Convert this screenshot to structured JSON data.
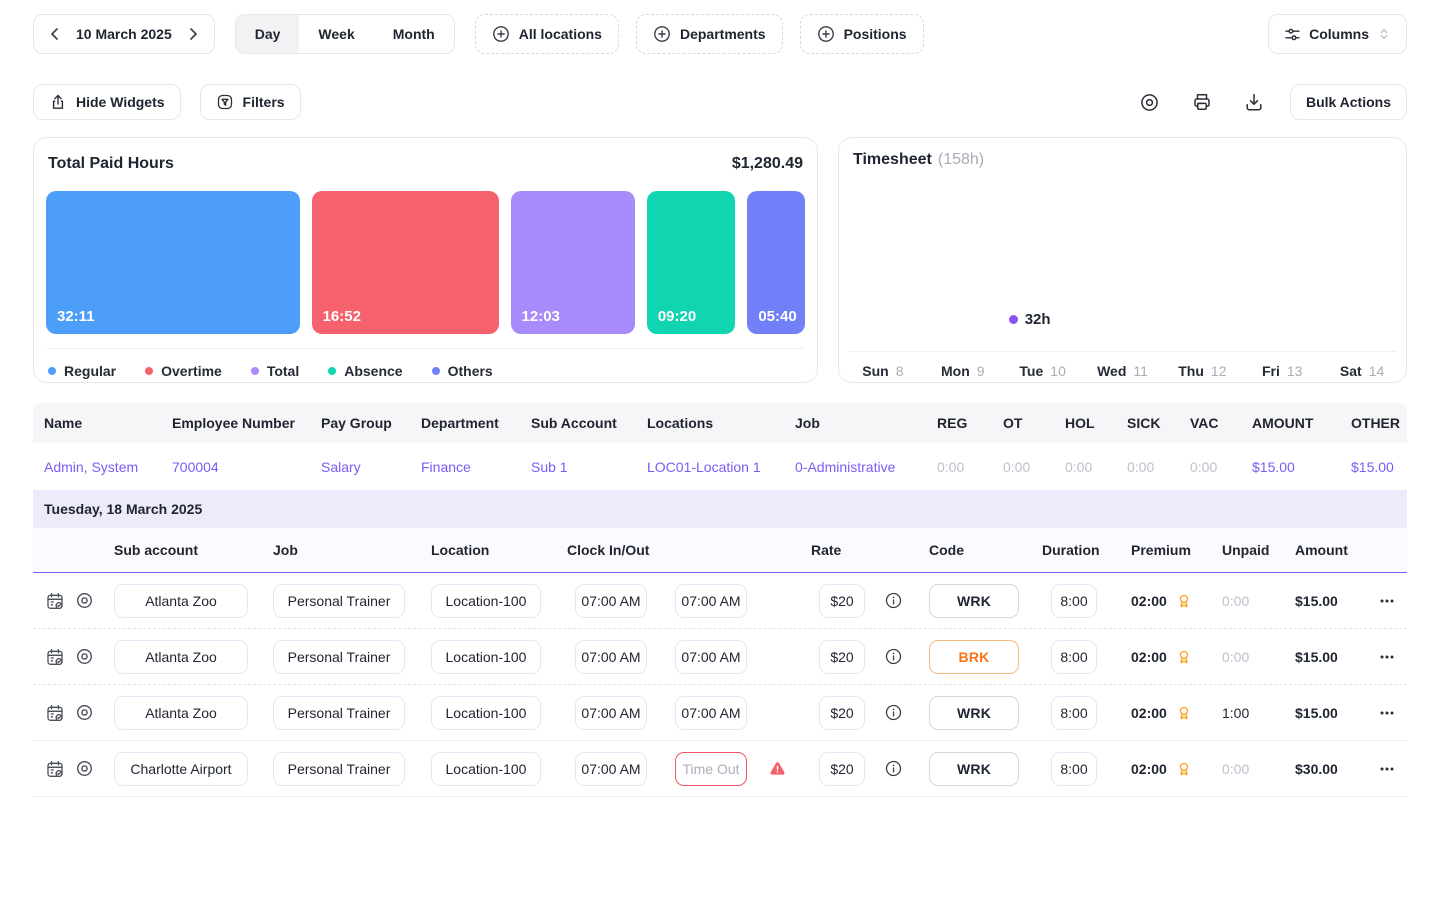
{
  "colors": {
    "accent_purple": "#7B5BF5",
    "bar_blue": "#4D9EF8",
    "bar_red": "#F5626D",
    "bar_purple": "#A78BFA",
    "bar_teal": "#10D5B0",
    "bar_indigo": "#7180F8",
    "timesheet_bar_purple": "#8A53F3",
    "timesheet_bar_gray": "#F4F4F5",
    "brk_orange": "#F97316",
    "premium_amber": "#F6A723",
    "warning_red": "#F5626D"
  },
  "toolbar": {
    "date_label": "10 March 2025",
    "tabs": {
      "day": "Day",
      "week": "Week",
      "month": "Month"
    },
    "active_tab": "Day",
    "all_locations_label": "All locations",
    "departments_label": "Departments",
    "positions_label": "Positions",
    "columns_label": "Columns"
  },
  "action_bar": {
    "hide_widgets_label": "Hide Widgets",
    "filters_label": "Filters",
    "bulk_actions_label": "Bulk Actions"
  },
  "paid_hours_card": {
    "title": "Total Paid Hours",
    "total_amount": "$1,280.49",
    "segments": [
      {
        "label": "32:11",
        "legend": "Regular",
        "color": "#4D9EF8",
        "flex": "255"
      },
      {
        "label": "16:52",
        "legend": "Overtime",
        "color": "#F5626D",
        "flex": "188"
      },
      {
        "label": "12:03",
        "legend": "Total",
        "color": "#A78BFA",
        "flex": "125"
      },
      {
        "label": "09:20",
        "legend": "Absence",
        "color": "#10D5B0",
        "flex": "89"
      },
      {
        "label": "05:40",
        "legend": "Others",
        "color": "#7180F8",
        "flex": "58"
      }
    ]
  },
  "timesheet_card": {
    "title": "Timesheet",
    "total_hours": "(158h)",
    "tooltip_label": "32h",
    "tooltip_day": "Tue",
    "days": [
      {
        "day": "Sun",
        "date": "8",
        "height_pct": "31"
      },
      {
        "day": "Mon",
        "date": "9",
        "height_pct": "100"
      },
      {
        "day": "Tue",
        "date": "10",
        "height_pct": "54"
      },
      {
        "day": "Wed",
        "date": "11",
        "height_pct": "68"
      },
      {
        "day": "Thu",
        "date": "12",
        "height_pct": "78"
      },
      {
        "day": "Fri",
        "date": "13",
        "height_pct": "100"
      },
      {
        "day": "Sat",
        "date": "14",
        "height_pct": "37"
      }
    ]
  },
  "summary_table": {
    "headers": {
      "name": "Name",
      "employee_number": "Employee Number",
      "pay_group": "Pay Group",
      "department": "Department",
      "sub_account": "Sub Account",
      "locations": "Locations",
      "job": "Job",
      "reg": "REG",
      "ot": "OT",
      "hol": "HOL",
      "sick": "SICK",
      "vac": "VAC",
      "amount": "AMOUNT",
      "other": "OTHER"
    },
    "row": {
      "name": "Admin, System",
      "employee_number": "700004",
      "pay_group": "Salary",
      "department": "Finance",
      "sub_account": "Sub 1",
      "locations": "LOC01-Location 1",
      "job": "0-Administrative",
      "reg": "0:00",
      "ot": "0:00",
      "hol": "0:00",
      "sick": "0:00",
      "vac": "0:00",
      "amount": "$15.00",
      "other": "$15.00"
    }
  },
  "day_section": {
    "title": "Tuesday, 18 March 2025",
    "headers": {
      "sub_account": "Sub account",
      "job": "Job",
      "location": "Location",
      "clock": "Clock In/Out",
      "rate": "Rate",
      "code": "Code",
      "duration": "Duration",
      "premium": "Premium",
      "unpaid": "Unpaid",
      "amount": "Amount"
    },
    "rows": [
      {
        "sub_account": "Atlanta Zoo",
        "job": "Personal Trainer",
        "location": "Location-100",
        "clock_in": "07:00 AM",
        "clock_out": "07:00 AM",
        "rate": "$20",
        "code": "WRK",
        "duration": "8:00",
        "premium": "02:00",
        "unpaid": "0:00",
        "amount": "$15.00"
      },
      {
        "sub_account": "Atlanta Zoo",
        "job": "Personal Trainer",
        "location": "Location-100",
        "clock_in": "07:00 AM",
        "clock_out": "07:00 AM",
        "rate": "$20",
        "code": "BRK",
        "duration": "8:00",
        "premium": "02:00",
        "unpaid": "0:00",
        "amount": "$15.00"
      },
      {
        "sub_account": "Atlanta Zoo",
        "job": "Personal Trainer",
        "location": "Location-100",
        "clock_in": "07:00 AM",
        "clock_out": "07:00 AM",
        "rate": "$20",
        "code": "WRK",
        "duration": "8:00",
        "premium": "02:00",
        "unpaid": "1:00",
        "amount": "$15.00"
      },
      {
        "sub_account": "Charlotte Airport",
        "job": "Personal Trainer",
        "location": "Location-100",
        "clock_in": "07:00 AM",
        "clock_out": "Time Out",
        "rate": "$20",
        "code": "WRK",
        "duration": "8:00",
        "premium": "02:00",
        "unpaid": "0:00",
        "amount": "$30.00"
      }
    ]
  }
}
